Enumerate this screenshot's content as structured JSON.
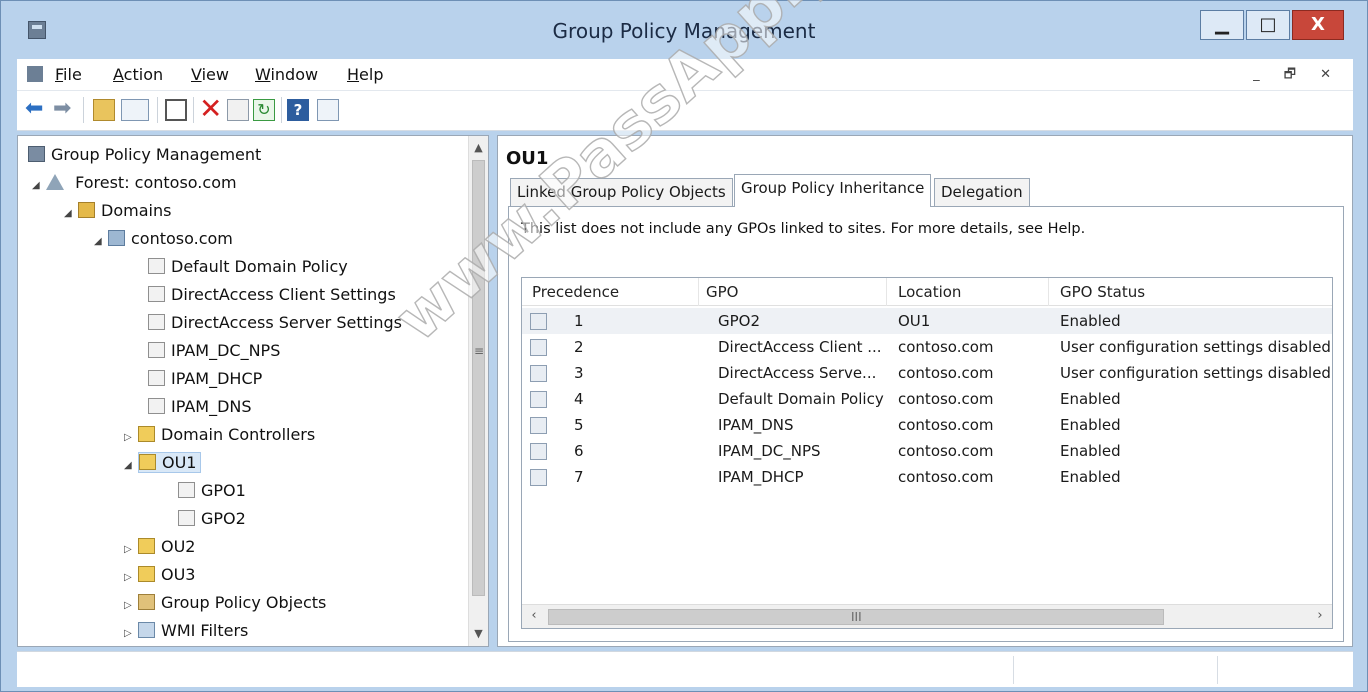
{
  "window": {
    "title": "Group Policy Management"
  },
  "menu": [
    {
      "label": "File",
      "accel": "F",
      "rest": "ile"
    },
    {
      "label": "Action",
      "accel": "A",
      "rest": "ction"
    },
    {
      "label": "View",
      "accel": "V",
      "rest": "iew"
    },
    {
      "label": "Window",
      "accel": "W",
      "rest": "indow"
    },
    {
      "label": "Help",
      "accel": "H",
      "rest": "elp"
    }
  ],
  "tree": {
    "root": "Group Policy Management",
    "forest": "Forest: contoso.com",
    "domains": "Domains",
    "domain": "contoso.com",
    "gpo_links": [
      "Default Domain Policy",
      "DirectAccess Client Settings",
      "DirectAccess Server Settings",
      "IPAM_DC_NPS",
      "IPAM_DHCP",
      "IPAM_DNS"
    ],
    "domain_controllers": "Domain Controllers",
    "ou1": "OU1",
    "ou1_children": [
      "GPO1",
      "GPO2"
    ],
    "ou2": "OU2",
    "ou3": "OU3",
    "gpo_container": "Group Policy Objects",
    "wmi_filters": "WMI Filters"
  },
  "details": {
    "title": "OU1",
    "tabs": [
      "Linked Group Policy Objects",
      "Group Policy Inheritance",
      "Delegation"
    ],
    "active_tab": "Group Policy Inheritance",
    "info_text": "This list does not include any GPOs linked to sites. For more details, see Help.",
    "columns": [
      "Precedence",
      "GPO",
      "Location",
      "GPO Status"
    ],
    "rows": [
      {
        "precedence": "1",
        "gpo": "GPO2",
        "location": "OU1",
        "status": "Enabled"
      },
      {
        "precedence": "2",
        "gpo": "DirectAccess Client ...",
        "location": "contoso.com",
        "status": "User configuration settings disabled"
      },
      {
        "precedence": "3",
        "gpo": "DirectAccess Serve...",
        "location": "contoso.com",
        "status": "User configuration settings disabled"
      },
      {
        "precedence": "4",
        "gpo": "Default Domain Policy",
        "location": "contoso.com",
        "status": "Enabled"
      },
      {
        "precedence": "5",
        "gpo": "IPAM_DNS",
        "location": "contoso.com",
        "status": "Enabled"
      },
      {
        "precedence": "6",
        "gpo": "IPAM_DC_NPS",
        "location": "contoso.com",
        "status": "Enabled"
      },
      {
        "precedence": "7",
        "gpo": "IPAM_DHCP",
        "location": "contoso.com",
        "status": "Enabled"
      }
    ]
  },
  "watermark": "www.PassApply.com"
}
